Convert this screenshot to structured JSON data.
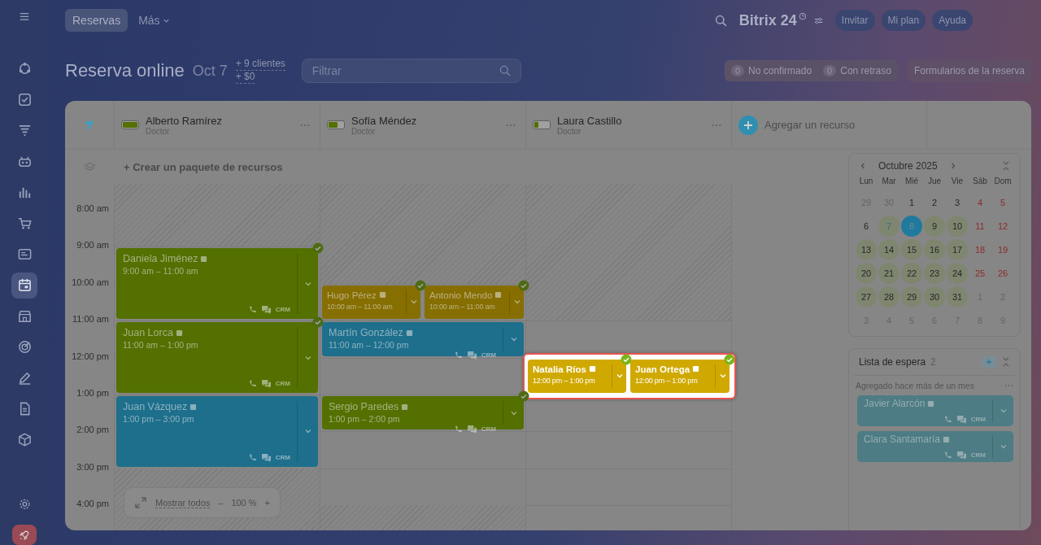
{
  "sidebar": {
    "items": [
      {
        "selected": false
      },
      {
        "selected": false
      },
      {
        "selected": false
      },
      {
        "selected": false
      },
      {
        "selected": false
      },
      {
        "selected": false
      },
      {
        "selected": false
      },
      {
        "selected": true
      },
      {
        "selected": false
      },
      {
        "selected": false
      },
      {
        "selected": false
      },
      {
        "selected": false
      },
      {
        "selected": false
      }
    ]
  },
  "topbar": {
    "tabs": [
      {
        "label": "Reservas",
        "selected": true
      },
      {
        "label": "Más",
        "selected": false
      }
    ],
    "logo": "Bitrix 24",
    "buttons": [
      "Invitar",
      "Mi plan",
      "Ayuda"
    ]
  },
  "header": {
    "title": "Reserva online",
    "date": "Oct 7",
    "stats": [
      "+ 9 clientes",
      "+ $0"
    ],
    "filter": {
      "placeholder": "Filtrar"
    },
    "counters": [
      {
        "count": "0",
        "label": "No confirmado"
      },
      {
        "count": "0",
        "label": "Con retraso"
      }
    ],
    "forms_button": "Formularios de la reserva"
  },
  "resources": [
    {
      "name": "Alberto Ramírez",
      "role": "Doctor",
      "level": 1,
      "bookings": [
        {
          "name": "Daniela Jiménez",
          "time": "9:00 am – 11:00 am",
          "color": "#537000",
          "confirmed": true,
          "highlighted": false,
          "crm": "CRM"
        },
        {
          "name": "Juan Lorca",
          "time": "11:00 am – 1:00 pm",
          "color": "#537000",
          "confirmed": true,
          "highlighted": false,
          "crm": "CRM"
        },
        {
          "name": "Juan Vázquez",
          "time": "1:00 pm – 3:00 pm",
          "color": "#1d6f8c",
          "confirmed": false,
          "highlighted": false,
          "crm": "CRM"
        }
      ]
    },
    {
      "name": "Sofía Méndez",
      "role": "Doctor",
      "level": 0.6,
      "bookings": [
        {
          "name": "Hugo Pérez",
          "time": "10:00 am – 11:00 am",
          "color": "#866e00",
          "confirmed": true,
          "highlighted": false
        },
        {
          "name": "Antonio Mendo",
          "time": "10:00 am – 11:00 am",
          "color": "#866e00",
          "confirmed": true,
          "highlighted": false
        },
        {
          "name": "Martín González",
          "time": "11:00 am – 12:00 pm",
          "color": "#1d6f8c",
          "confirmed": false,
          "highlighted": false,
          "crm": "CRM"
        },
        {
          "name": "Sergio Paredes",
          "time": "1:00 pm – 2:00 pm",
          "color": "#537000",
          "confirmed": true,
          "highlighted": false,
          "crm": "CRM"
        }
      ]
    },
    {
      "name": "Laura Castillo",
      "role": "Doctor",
      "level": 0.25,
      "bookings": [
        {
          "name": "Natalia Ríos",
          "time": "12:00 pm – 1:00 pm",
          "color": "#d0a900",
          "confirmed": true,
          "highlighted": true
        },
        {
          "name": "Juan Ortega",
          "time": "12:00 pm – 1:00 pm",
          "color": "#d0a900",
          "confirmed": true,
          "highlighted": true
        }
      ]
    }
  ],
  "add_resource": "Agregar un recurso",
  "create_package": "+ Crear un paquete de recursos",
  "timeline": {
    "hours": [
      "8:00 am",
      "9:00 am",
      "10:00 am",
      "11:00 am",
      "12:00 pm",
      "1:00 pm",
      "2:00 pm",
      "3:00 pm",
      "4:00 pm"
    ]
  },
  "zoom_control": {
    "show_all": "Mostrar todos",
    "minus": "–",
    "value": "100 %",
    "plus": "+"
  },
  "mini_calendar": {
    "title": "Octubre 2025",
    "weekdays": [
      "Lun",
      "Mar",
      "Mié",
      "Jue",
      "Vie",
      "Sáb",
      "Dom"
    ],
    "days": [
      {
        "text": "29",
        "outside": true,
        "marked": false,
        "selected": false,
        "today": false
      },
      {
        "text": "30",
        "outside": true,
        "marked": false,
        "selected": false,
        "today": false
      },
      {
        "text": "1",
        "outside": false,
        "marked": false,
        "selected": false,
        "today": false
      },
      {
        "text": "2",
        "outside": false,
        "marked": false,
        "selected": false,
        "today": false
      },
      {
        "text": "3",
        "outside": false,
        "marked": false,
        "selected": false,
        "today": false
      },
      {
        "text": "4",
        "outside": false,
        "marked": false,
        "selected": false,
        "today": false
      },
      {
        "text": "5",
        "outside": false,
        "marked": false,
        "selected": false,
        "today": false
      },
      {
        "text": "6",
        "outside": false,
        "marked": false,
        "selected": false,
        "today": false
      },
      {
        "text": "7",
        "outside": false,
        "marked": true,
        "selected": false,
        "today": true
      },
      {
        "text": "8",
        "outside": false,
        "marked": false,
        "selected": true,
        "today": false
      },
      {
        "text": "9",
        "outside": false,
        "marked": true,
        "selected": false,
        "today": false
      },
      {
        "text": "10",
        "outside": false,
        "marked": true,
        "selected": false,
        "today": false
      },
      {
        "text": "11",
        "outside": false,
        "marked": false,
        "selected": false,
        "today": false
      },
      {
        "text": "12",
        "outside": false,
        "marked": false,
        "selected": false,
        "today": false
      },
      {
        "text": "13",
        "outside": false,
        "marked": true,
        "selected": false,
        "today": false
      },
      {
        "text": "14",
        "outside": false,
        "marked": true,
        "selected": false,
        "today": false
      },
      {
        "text": "15",
        "outside": false,
        "marked": true,
        "selected": false,
        "today": false
      },
      {
        "text": "16",
        "outside": false,
        "marked": true,
        "selected": false,
        "today": false
      },
      {
        "text": "17",
        "outside": false,
        "marked": true,
        "selected": false,
        "today": false
      },
      {
        "text": "18",
        "outside": false,
        "marked": false,
        "selected": false,
        "today": false
      },
      {
        "text": "19",
        "outside": false,
        "marked": false,
        "selected": false,
        "today": false
      },
      {
        "text": "20",
        "outside": false,
        "marked": true,
        "selected": false,
        "today": false
      },
      {
        "text": "21",
        "outside": false,
        "marked": true,
        "selected": false,
        "today": false
      },
      {
        "text": "22",
        "outside": false,
        "marked": true,
        "selected": false,
        "today": false
      },
      {
        "text": "23",
        "outside": false,
        "marked": true,
        "selected": false,
        "today": false
      },
      {
        "text": "24",
        "outside": false,
        "marked": true,
        "selected": false,
        "today": false
      },
      {
        "text": "25",
        "outside": false,
        "marked": false,
        "selected": false,
        "today": false
      },
      {
        "text": "26",
        "outside": false,
        "marked": false,
        "selected": false,
        "today": false
      },
      {
        "text": "27",
        "outside": false,
        "marked": true,
        "selected": false,
        "today": false
      },
      {
        "text": "28",
        "outside": false,
        "marked": true,
        "selected": false,
        "today": false
      },
      {
        "text": "29",
        "outside": false,
        "marked": true,
        "selected": false,
        "today": false
      },
      {
        "text": "30",
        "outside": false,
        "marked": true,
        "selected": false,
        "today": false
      },
      {
        "text": "31",
        "outside": false,
        "marked": true,
        "selected": false,
        "today": false
      },
      {
        "text": "1",
        "outside": true,
        "marked": false,
        "selected": false,
        "today": false
      },
      {
        "text": "2",
        "outside": true,
        "marked": false,
        "selected": false,
        "today": false
      },
      {
        "text": "3",
        "outside": true,
        "marked": false,
        "selected": false,
        "today": false
      },
      {
        "text": "4",
        "outside": true,
        "marked": false,
        "selected": false,
        "today": false
      },
      {
        "text": "5",
        "outside": true,
        "marked": false,
        "selected": false,
        "today": false
      },
      {
        "text": "6",
        "outside": true,
        "marked": false,
        "selected": false,
        "today": false
      },
      {
        "text": "7",
        "outside": true,
        "marked": false,
        "selected": false,
        "today": false
      },
      {
        "text": "8",
        "outside": true,
        "marked": false,
        "selected": false,
        "today": false
      },
      {
        "text": "9",
        "outside": true,
        "marked": false,
        "selected": false,
        "today": false
      }
    ]
  },
  "waitlist": {
    "title": "Lista de espera",
    "count": "2",
    "group": "Agregado hace más de un mes",
    "items": [
      {
        "name": "Javier Alarcón",
        "crm": "CRM"
      },
      {
        "name": "Clara Santamaría",
        "crm": "CRM"
      }
    ]
  }
}
